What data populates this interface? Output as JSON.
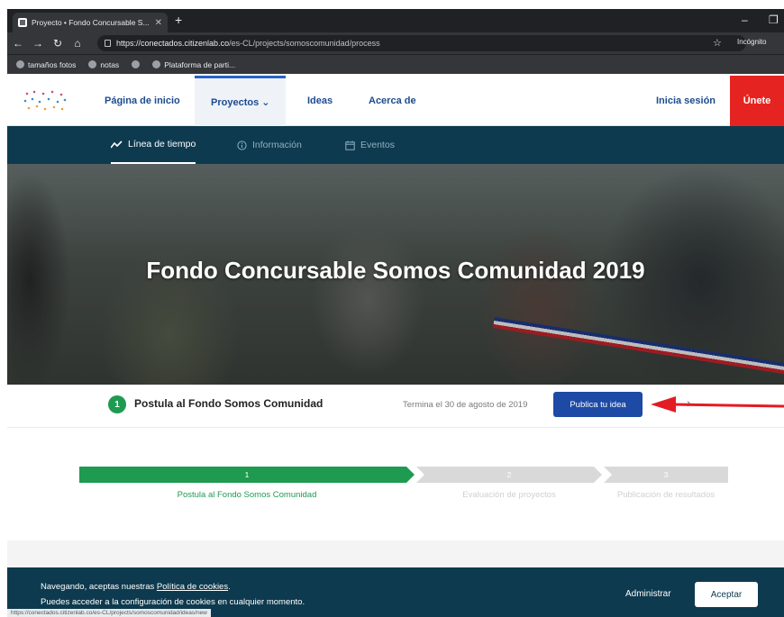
{
  "browser": {
    "tab_title": "Proyecto • Fondo Concursable S...",
    "new_tab": "+",
    "url_host": "https://conectados.citizenlab.co",
    "url_path": "/es-CL/projects/somoscomunidad/process",
    "incognito": "Incógnito",
    "bookmarks": [
      "tamaños fotos",
      "notas",
      "Plataforma de parti..."
    ]
  },
  "nav": {
    "home": "Página de inicio",
    "projects": "Proyectos ⌄",
    "ideas": "Ideas",
    "about": "Acerca de",
    "login": "Inicia sesión",
    "join": "Únete"
  },
  "subnav": {
    "timeline": "Línea de tiempo",
    "info": "Información",
    "events": "Eventos"
  },
  "hero": {
    "title": "Fondo Concursable Somos Comunidad 2019"
  },
  "phase": {
    "number": "1",
    "title": "Postula al Fondo Somos Comunidad",
    "ends": "Termina el 30 de agosto de 2019",
    "button": "Publica tu idea",
    "next": "›"
  },
  "timeline": {
    "steps": [
      {
        "num": "1",
        "label": "Postula al Fondo Somos Comunidad",
        "active": true
      },
      {
        "num": "2",
        "label": "Evaluación de proyectos",
        "active": false
      },
      {
        "num": "3",
        "label": "Publicación de resultados",
        "active": false
      }
    ]
  },
  "cookie": {
    "line1_prefix": "Navegando, aceptas nuestras ",
    "line1_link": "Política de cookies",
    "line1_suffix": ".",
    "line2": "Puedes acceder a la configuración de cookies en cualquier momento.",
    "admin": "Administrar",
    "accept": "Aceptar"
  },
  "status_url": "https://conectados.citizenlab.co/es-CL/projects/somoscomunidad/ideas/new",
  "colors": {
    "brand_blue": "#1d4aa5",
    "dark_teal": "#0e3a4f",
    "success_green": "#1e9b50",
    "join_red": "#e52421",
    "annotation_red": "#e31b23"
  }
}
